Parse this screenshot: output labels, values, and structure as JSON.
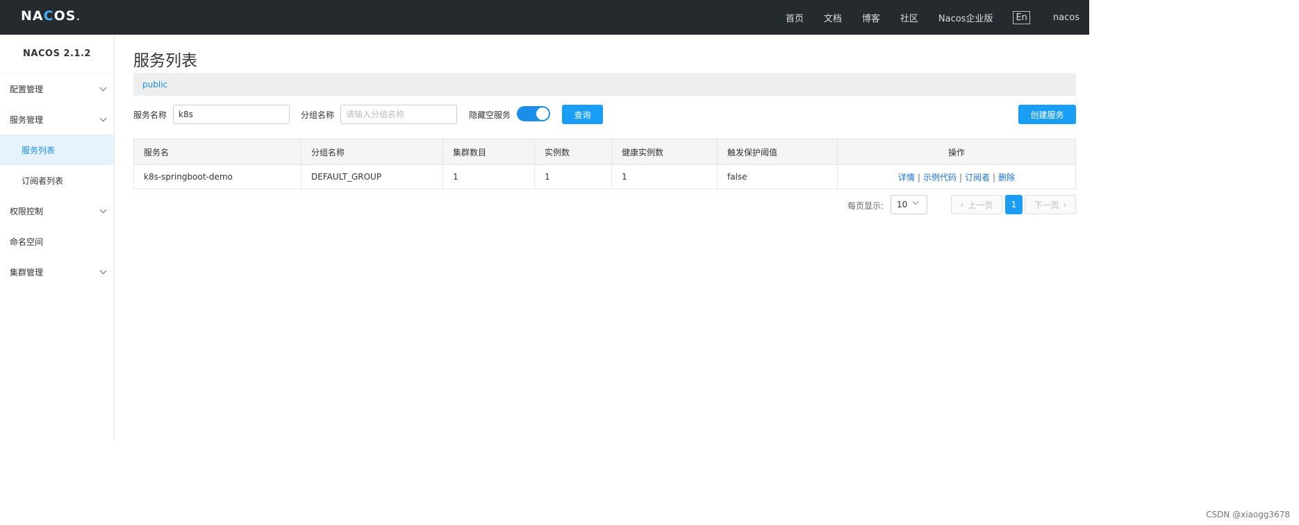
{
  "header": {
    "logo": {
      "part1": "NA",
      "part2": "C",
      "part3": "OS",
      "dot": "."
    },
    "nav": [
      "首页",
      "文档",
      "博客",
      "社区",
      "Nacos企业版"
    ],
    "lang": "En",
    "user": "nacos"
  },
  "sidebar": {
    "version": "NACOS 2.1.2",
    "items": [
      {
        "label": "配置管理",
        "expandable": true
      },
      {
        "label": "服务管理",
        "expandable": true
      },
      {
        "label": "服务列表",
        "sub": true,
        "active": true
      },
      {
        "label": "订阅者列表",
        "sub": true
      },
      {
        "label": "权限控制",
        "expandable": true
      },
      {
        "label": "命名空间"
      },
      {
        "label": "集群管理",
        "expandable": true
      }
    ]
  },
  "main": {
    "title": "服务列表",
    "namespace": "public",
    "filter": {
      "service_name_label": "服务名称",
      "service_name_value": "k8s",
      "group_name_label": "分组名称",
      "group_name_placeholder": "请输入分组名称",
      "hide_empty_label": "隐藏空服务",
      "hide_empty_on": true,
      "query_label": "查询",
      "create_label": "创建服务"
    },
    "table": {
      "headers": [
        "服务名",
        "分组名称",
        "集群数目",
        "实例数",
        "健康实例数",
        "触发保护阈值",
        "操作"
      ],
      "rows": [
        {
          "service": "k8s-springboot-demo",
          "group": "DEFAULT_GROUP",
          "clusters": "1",
          "instances": "1",
          "healthy": "1",
          "protect": "false"
        }
      ],
      "ops": [
        "详情",
        "示例代码",
        "订阅者",
        "删除"
      ],
      "ops_sep": "|"
    },
    "pager": {
      "label": "每页显示:",
      "size": "10",
      "prev": "上一页",
      "next": "下一页",
      "current": "1"
    }
  },
  "watermark": "CSDN @xiaogg3678",
  "colors": {
    "topbar": "#252a2f",
    "accent": "#1a9ef5",
    "link": "#1a6fd0"
  }
}
